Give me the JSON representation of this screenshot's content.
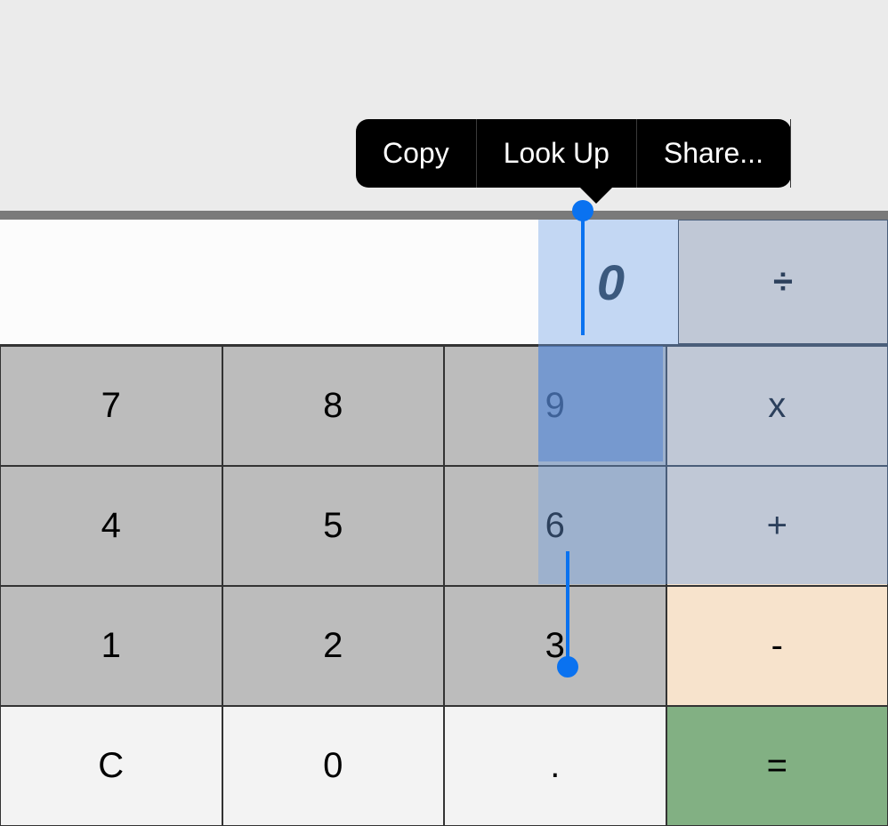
{
  "context_menu": {
    "copy": "Copy",
    "lookup": "Look Up",
    "share": "Share..."
  },
  "display": {
    "value": "0"
  },
  "keypad": {
    "divide": "÷",
    "seven": "7",
    "eight": "8",
    "nine": "9",
    "multiply": "x",
    "four": "4",
    "five": "5",
    "six": "6",
    "plus": "+",
    "one": "1",
    "two": "2",
    "three": "3",
    "minus": "-",
    "clear": "C",
    "zero": "0",
    "decimal": ".",
    "equals": "="
  }
}
